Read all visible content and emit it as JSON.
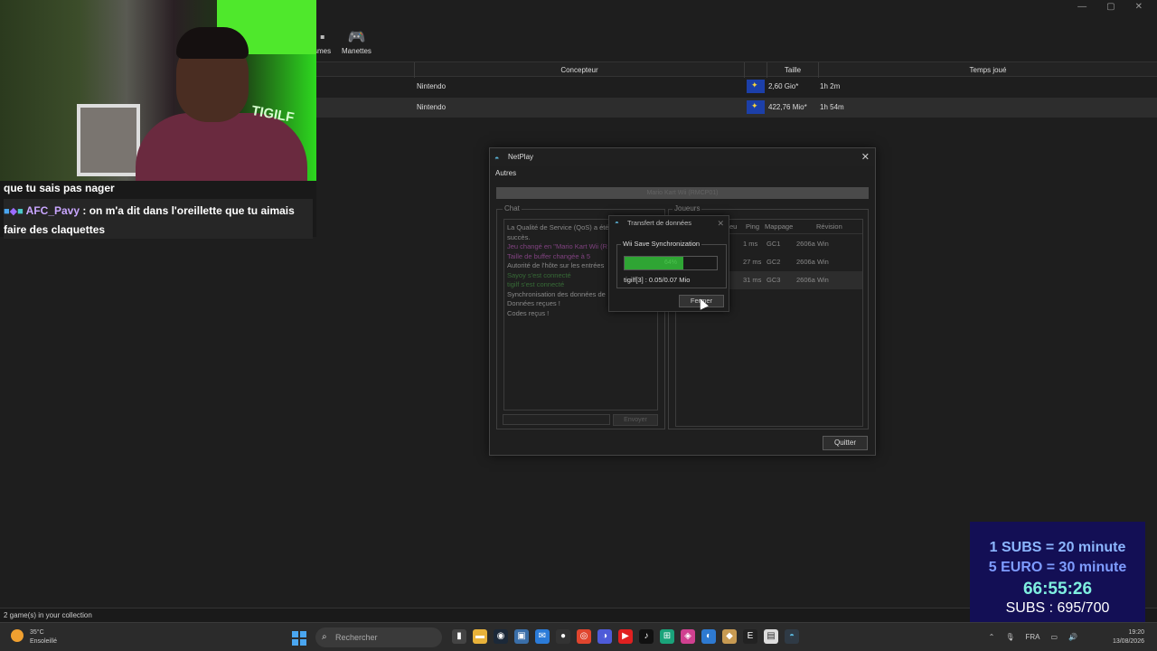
{
  "app": {
    "toolbar": {
      "partial_label": "smes",
      "controllers_label": "Manettes"
    },
    "table": {
      "columns": [
        "Concepteur",
        "Taille",
        "Temps joué"
      ],
      "rows": [
        {
          "developer": "Nintendo",
          "size": "2,60 Gio*",
          "time": "1h 2m"
        },
        {
          "developer": "Nintendo",
          "size": "422,76 Mio*",
          "time": "1h 54m"
        }
      ]
    },
    "status": "2 game(s) in your collection"
  },
  "webcam": {
    "sign_text": "TIGILF",
    "chat": {
      "line1": "que tu sais pas nager",
      "username": "AFC_Pavy",
      "message": " : on m'a dit dans l'oreillette que tu aimais faire des claquettes"
    }
  },
  "netplay": {
    "title": "NetPlay",
    "menu_other": "Autres",
    "game": "Mario Kart Wii (RMCP01)",
    "chat_legend": "Chat",
    "chat_lines": [
      {
        "text": "La Qualité de Service (QoS) a été",
        "color": "#dddddd"
      },
      {
        "text": "succès.",
        "color": "#dddddd"
      },
      {
        "text": "Jeu changé en \"Mario Kart Wii (R",
        "color": "#d05fd0"
      },
      {
        "text": "Taille de buffer changée à 5",
        "color": "#d05fd0"
      },
      {
        "text": "Autorité de l'hôte sur les entrées",
        "color": "#dddddd"
      },
      {
        "text": "Sayoy s'est connecté",
        "color": "#4aa84a"
      },
      {
        "text": "tigilf s'est connecté",
        "color": "#4aa84a"
      },
      {
        "text": "Synchronisation des données de",
        "color": "#dddddd"
      },
      {
        "text": "Données reçues !",
        "color": "#dddddd"
      },
      {
        "text": "Codes reçus !",
        "color": "#dddddd"
      }
    ],
    "chat_send": "Envoyer",
    "players_legend": "Joueurs",
    "players_columns": [
      "eu",
      "Ping",
      "Mappage",
      "Révision"
    ],
    "players": [
      {
        "game": "",
        "ping": "1 ms",
        "mapping": "GC1",
        "revision": "2606a Win"
      },
      {
        "game": "",
        "ping": "27 ms",
        "mapping": "GC2",
        "revision": "2606a Win"
      },
      {
        "game": "",
        "ping": "31 ms",
        "mapping": "GC3",
        "revision": "2606a Win"
      }
    ],
    "quit": "Quitter"
  },
  "transfer": {
    "title": "Transfert de données",
    "group": "Wii Save Synchronization",
    "progress_label": "64%",
    "progress_fraction": 0.64,
    "info": "tigilf[3] : 0.05/0.07 Mio",
    "close": "Fermer"
  },
  "subs_overlay": {
    "line1": "1 SUBS = 20 minute",
    "line2": "5 EURO = 30 minute",
    "timer": "66:55:26",
    "count": "SUBS : 695/700"
  },
  "taskbar": {
    "weather_temp": "35°C",
    "weather_desc": "Ensoleillé",
    "search_placeholder": "Rechercher",
    "lang": "FRA",
    "time": "19:20",
    "date": "13/08/2026"
  }
}
